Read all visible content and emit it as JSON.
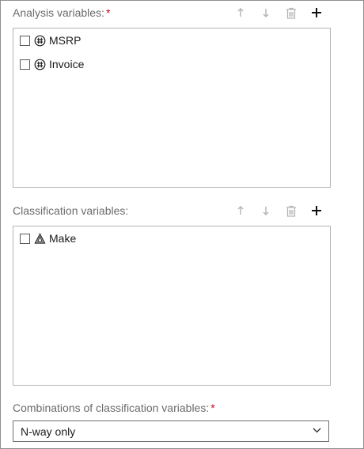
{
  "analysis": {
    "label": "Analysis variables:",
    "required_mark": "*",
    "variables": [
      {
        "name": "MSRP",
        "icon": "numeric-variable-icon"
      },
      {
        "name": "Invoice",
        "icon": "numeric-variable-icon"
      }
    ]
  },
  "classification": {
    "label": "Classification variables:",
    "variables": [
      {
        "name": "Make",
        "icon": "character-variable-icon"
      }
    ]
  },
  "combinations": {
    "label": "Combinations of classification variables:",
    "required_mark": "*",
    "selected": "N-way only"
  },
  "colors": {
    "label_gray": "#6b6b6b",
    "required_red": "#d0021b",
    "disabled_icon": "#b3b3b3",
    "border": "#b5b5b5"
  }
}
